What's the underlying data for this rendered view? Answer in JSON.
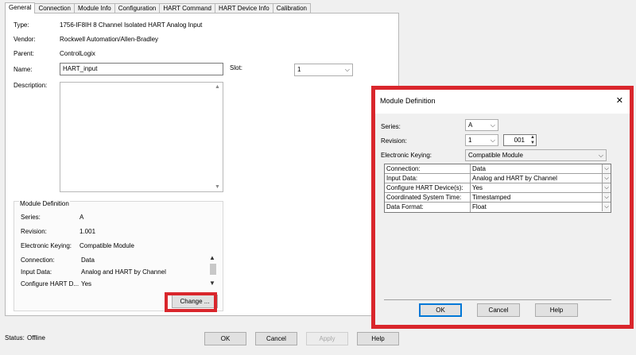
{
  "tabs": [
    "General",
    "Connection",
    "Module Info",
    "Configuration",
    "HART Command",
    "HART Device Info",
    "Calibration"
  ],
  "general": {
    "type_label": "Type:",
    "type_value": "1756-IF8IH 8 Channel Isolated HART Analog Input",
    "vendor_label": "Vendor:",
    "vendor_value": "Rockwell Automation/Allen-Bradley",
    "parent_label": "Parent:",
    "parent_value": "ControlLogix",
    "name_label": "Name:",
    "name_value": "HART_input",
    "slot_label": "Slot:",
    "slot_value": "1",
    "description_label": "Description:"
  },
  "module_definition": {
    "title": "Module Definition",
    "series_label": "Series:",
    "series_value": "A",
    "revision_label": "Revision:",
    "revision_value": "1.001",
    "keying_label": "Electronic Keying:",
    "keying_value": "Compatible Module",
    "rows": [
      {
        "key": "Connection:",
        "value": "Data"
      },
      {
        "key": "Input Data:",
        "value": "Analog and HART by Channel"
      },
      {
        "key": "Configure HART D...",
        "value": "Yes"
      }
    ],
    "change_button": "Change ..."
  },
  "status": {
    "label": "Status:",
    "value": "Offline"
  },
  "bottom_buttons": {
    "ok": "OK",
    "cancel": "Cancel",
    "apply": "Apply",
    "help": "Help"
  },
  "dialog": {
    "title": "Module Definition",
    "close": "✕",
    "series_label": "Series:",
    "series_value": "A",
    "revision_label": "Revision:",
    "revision_major": "1",
    "revision_minor": "001",
    "keying_label": "Electronic Keying:",
    "keying_value": "Compatible Module",
    "grid": [
      {
        "key": "Connection:",
        "value": "Data"
      },
      {
        "key": "Input Data:",
        "value": "Analog and HART by Channel"
      },
      {
        "key": "Configure HART Device(s):",
        "value": "Yes"
      },
      {
        "key": "Coordinated System Time:",
        "value": "Timestamped"
      },
      {
        "key": "Data Format:",
        "value": "Float"
      }
    ],
    "ok": "OK",
    "cancel": "Cancel",
    "help": "Help"
  },
  "icons": {
    "chevron_down": "⌵",
    "arrow_up": "▲",
    "arrow_down": "▼"
  },
  "colors": {
    "highlight_red": "#d9262c",
    "focus_blue": "#0078d7"
  }
}
